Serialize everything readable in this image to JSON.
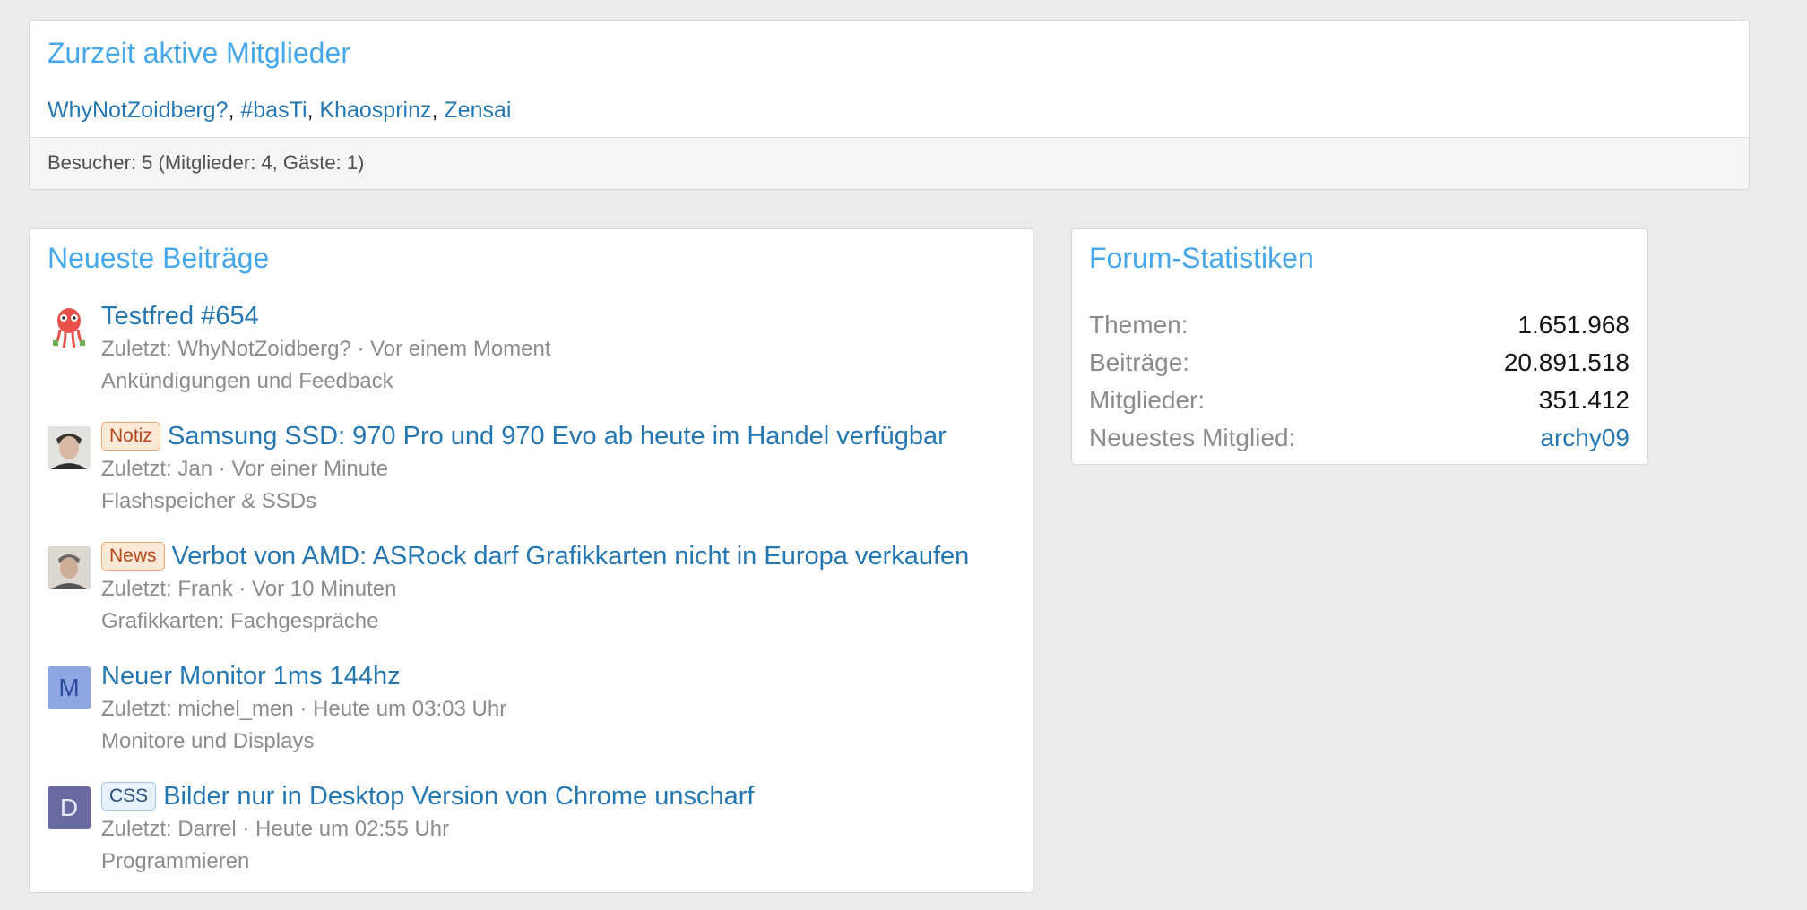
{
  "active_members": {
    "title": "Zurzeit aktive Mitglieder",
    "members": [
      "WhyNotZoidberg?",
      "#basTi",
      "Khaosprinz",
      "Zensai"
    ],
    "separator": ", ",
    "footer": "Besucher: 5 (Mitglieder: 4, Gäste: 1)"
  },
  "latest_posts": {
    "title": "Neueste Beiträge",
    "items": [
      {
        "avatar": "zoidberg-icon",
        "label": "",
        "title": "Testfred #654",
        "meta": "Zuletzt: WhyNotZoidberg? · Vor einem Moment",
        "forum": "Ankündigungen und Feedback"
      },
      {
        "avatar": "user-photo",
        "label": "Notiz",
        "title": "Samsung SSD: 970 Pro und 970 Evo ab heute im Handel verfügbar",
        "meta": "Zuletzt: Jan · Vor einer Minute",
        "forum": "Flashspeicher & SSDs"
      },
      {
        "avatar": "user-photo",
        "label": "News",
        "title": "Verbot von AMD: ASRock darf Grafikkarten nicht in Europa verkaufen",
        "meta": "Zuletzt: Frank · Vor 10 Minuten",
        "forum": "Grafikkarten: Fachgespräche"
      },
      {
        "avatar_letter": "M",
        "label": "",
        "title": "Neuer Monitor 1ms 144hz",
        "meta": "Zuletzt: michel_men · Heute um 03:03 Uhr",
        "forum": "Monitore und Displays"
      },
      {
        "avatar_letter": "D",
        "label": "CSS",
        "title": "Bilder nur in Desktop Version von Chrome unscharf",
        "meta": "Zuletzt: Darrel · Heute um 02:55 Uhr",
        "forum": "Programmieren"
      }
    ]
  },
  "forum_stats": {
    "title": "Forum-Statistiken",
    "rows": [
      {
        "label": "Themen:",
        "value": "1.651.968"
      },
      {
        "label": "Beiträge:",
        "value": "20.891.518"
      },
      {
        "label": "Mitglieder:",
        "value": "351.412"
      },
      {
        "label": "Neuestes Mitglied:",
        "value": "archy09"
      }
    ]
  },
  "colors": {
    "header": "#47a7eb",
    "link": "#2577b1",
    "muted": "#8c8c8c",
    "label_orange": "#b5481b",
    "label_blue": "#2a4f7a"
  }
}
